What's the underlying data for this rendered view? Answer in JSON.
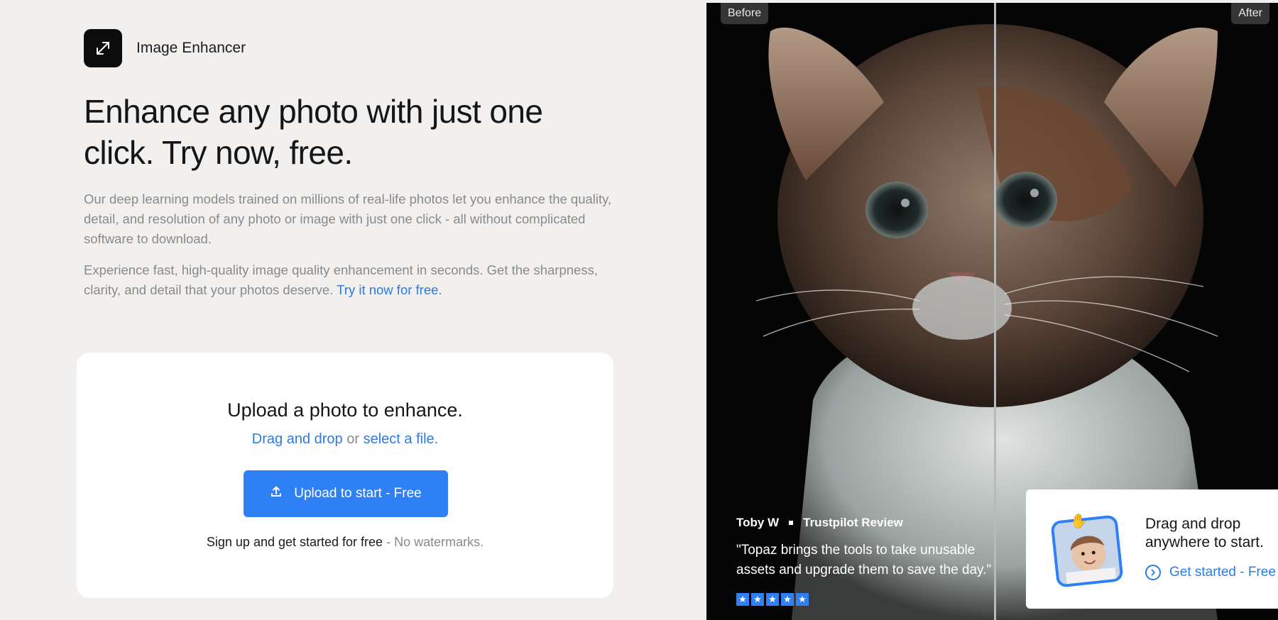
{
  "brand": {
    "name": "Image Enhancer",
    "icon": "expand-arrows-icon"
  },
  "hero_text": {
    "headline": "Enhance any photo with just one click. Try now, free.",
    "paragraph1": "Our deep learning models trained on millions of real-life photos let you enhance the quality, detail, and resolution of any photo or image with just one click - all without complicated software to download.",
    "paragraph2": "Experience fast, high-quality image quality enhancement in seconds. Get the sharpness, clarity, and detail that your photos deserve.",
    "paragraph2_link": "Try it now for free."
  },
  "upload": {
    "title": "Upload a photo to enhance.",
    "drag_link": "Drag and drop",
    "or_text": "or",
    "select_link": "select a file.",
    "button_label": "Upload to start - Free",
    "footer_main": "Sign up and get started for free",
    "footer_muted": "- No watermarks."
  },
  "comparison": {
    "before_label": "Before",
    "after_label": "After"
  },
  "review": {
    "author": "Toby W",
    "source": "Trustpilot Review",
    "quote": "\"Topaz brings the tools to take unusable assets and upgrade them to save the day.\"",
    "rating": 5
  },
  "drop_prompt": {
    "title": "Drag and drop anywhere to start.",
    "cta": "Get started - Free"
  },
  "colors": {
    "accent": "#2f7ff5",
    "link": "#2b7be0",
    "page_bg": "#f2f0ee"
  }
}
